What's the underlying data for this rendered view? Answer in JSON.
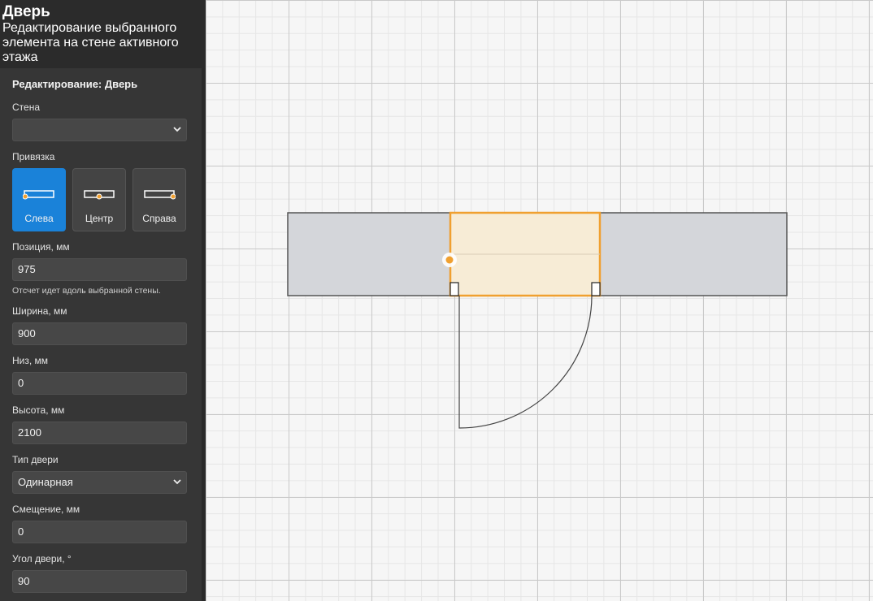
{
  "header": {
    "title": "Дверь",
    "subtitle": "Редактирование выбранного элемента на стене активного этажа"
  },
  "panel": {
    "section_title": "Редактирование: Дверь",
    "wall": {
      "label": "Стена",
      "value": ""
    },
    "snap": {
      "label": "Привязка",
      "options": [
        {
          "label": "Слева",
          "active": true
        },
        {
          "label": "Центр",
          "active": false
        },
        {
          "label": "Справа",
          "active": false
        }
      ]
    },
    "position": {
      "label": "Позиция, мм",
      "value": "975",
      "hint": "Отсчет идет вдоль выбранной стены."
    },
    "width": {
      "label": "Ширина, мм",
      "value": "900"
    },
    "bottom": {
      "label": "Низ, мм",
      "value": "0"
    },
    "height": {
      "label": "Высота, мм",
      "value": "2100"
    },
    "door_type": {
      "label": "Тип двери",
      "value": "Одинарная"
    },
    "offset": {
      "label": "Смещение, мм",
      "value": "0"
    },
    "angle": {
      "label": "Угол двери, °",
      "value": "90"
    }
  },
  "colors": {
    "accent": "#1a82d9",
    "door_outline": "#f0a030",
    "door_fill": "#f7ecd6",
    "wall_fill": "#d4d6da",
    "wall_stroke": "#555555"
  }
}
